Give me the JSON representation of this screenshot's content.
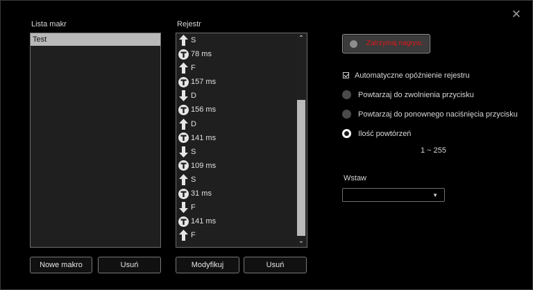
{
  "window": {
    "close_icon": "close-icon",
    "close_glyph": "✕"
  },
  "macros": {
    "label": "Lista makr",
    "items": [
      "Test"
    ],
    "new_button": "Nowe makro",
    "delete_button": "Usuń"
  },
  "register": {
    "label": "Rejestr",
    "rows": [
      {
        "icon": "up",
        "text": "S"
      },
      {
        "icon": "t",
        "text": "78 ms"
      },
      {
        "icon": "up",
        "text": "F"
      },
      {
        "icon": "t",
        "text": "157 ms"
      },
      {
        "icon": "down",
        "text": "D"
      },
      {
        "icon": "t",
        "text": "156 ms"
      },
      {
        "icon": "up",
        "text": "D"
      },
      {
        "icon": "t",
        "text": "141 ms"
      },
      {
        "icon": "down",
        "text": "S"
      },
      {
        "icon": "t",
        "text": "109 ms"
      },
      {
        "icon": "up",
        "text": "S"
      },
      {
        "icon": "t",
        "text": "31 ms"
      },
      {
        "icon": "down",
        "text": "F"
      },
      {
        "icon": "t",
        "text": "141 ms"
      },
      {
        "icon": "up",
        "text": "F"
      }
    ],
    "modify_button": "Modyfikuj",
    "delete_button": "Usuń"
  },
  "recording": {
    "stop_button": "Zatrzymaj nagryw..."
  },
  "options": {
    "auto_delay": "Automatyczne opóźnienie rejestru",
    "repeat_release": "Powtarzaj do zwolnienia przycisku",
    "repeat_press": "Powtarzaj do ponownego naciśnięcia przycisku",
    "repeat_count": "Ilość powtórzeń",
    "range": "1 ~ 255"
  },
  "insert": {
    "label": "Wstaw",
    "value": ""
  },
  "colors": {
    "record_text": "#e01818",
    "selection": "#b9b9b9",
    "panel": "#1f1f1f"
  }
}
